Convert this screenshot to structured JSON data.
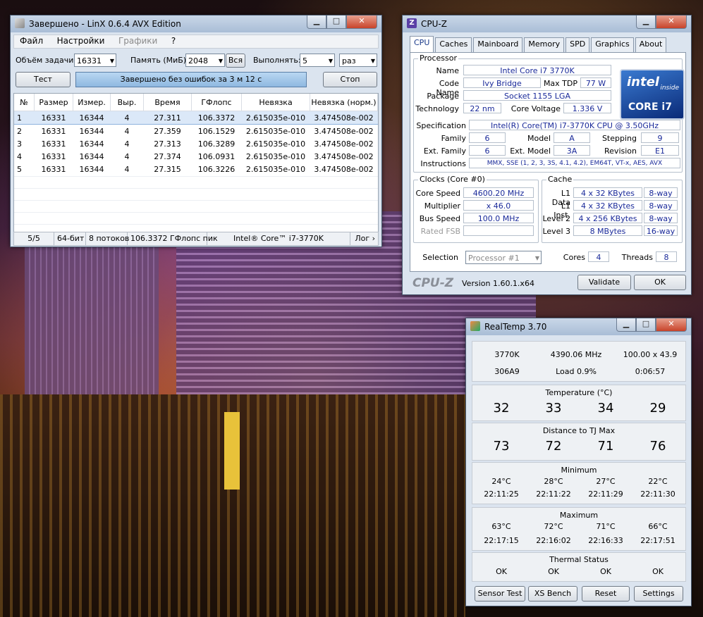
{
  "linx": {
    "title": "Завершено - LinX 0.6.4 AVX Edition",
    "menu": [
      "Файл",
      "Настройки",
      "Графики",
      "?"
    ],
    "problem_size_label": "Объём задачи:",
    "problem_size_value": "16331",
    "memory_label": "Память (МиБ):",
    "memory_value": "2048",
    "all_button": "Вся",
    "run_label": "Выполнять:",
    "run_value": "5",
    "run_unit": "раз",
    "test_button": "Тест",
    "progress_text": "Завершено без ошибок за 3 м 12 с",
    "stop_button": "Стоп",
    "columns": [
      "№",
      "Размер",
      "Измер.",
      "Выр.",
      "Время",
      "ГФлопс",
      "Невязка",
      "Невязка (норм.)"
    ],
    "rows": [
      [
        "1",
        "16331",
        "16344",
        "4",
        "27.311",
        "106.3372",
        "2.615035e-010",
        "3.474508e-002"
      ],
      [
        "2",
        "16331",
        "16344",
        "4",
        "27.359",
        "106.1529",
        "2.615035e-010",
        "3.474508e-002"
      ],
      [
        "3",
        "16331",
        "16344",
        "4",
        "27.313",
        "106.3289",
        "2.615035e-010",
        "3.474508e-002"
      ],
      [
        "4",
        "16331",
        "16344",
        "4",
        "27.374",
        "106.0931",
        "2.615035e-010",
        "3.474508e-002"
      ],
      [
        "5",
        "16331",
        "16344",
        "4",
        "27.315",
        "106.3226",
        "2.615035e-010",
        "3.474508e-002"
      ]
    ],
    "status": {
      "runs": "5/5",
      "bits": "64-бит",
      "threads": "8 потоков",
      "peak": "106.3372 ГФлопс пик",
      "cpu": "Intel® Core™ i7-3770K",
      "log": "Лог ›"
    }
  },
  "cpuz": {
    "title": "CPU-Z",
    "tabs": [
      "CPU",
      "Caches",
      "Mainboard",
      "Memory",
      "SPD",
      "Graphics",
      "About"
    ],
    "processor_label": "Processor",
    "name_label": "Name",
    "name": "Intel Core i7 3770K",
    "codename_label": "Code Name",
    "codename": "Ivy Bridge",
    "tdp_label": "Max TDP",
    "tdp": "77 W",
    "package_label": "Package",
    "package": "Socket 1155 LGA",
    "tech_label": "Technology",
    "tech": "22 nm",
    "voltage_label": "Core Voltage",
    "voltage": "1.336 V",
    "spec_label": "Specification",
    "spec": "Intel(R) Core(TM) i7-3770K CPU @ 3.50GHz",
    "family_label": "Family",
    "family": "6",
    "model_label": "Model",
    "model": "A",
    "stepping_label": "Stepping",
    "stepping": "9",
    "extfamily_label": "Ext. Family",
    "extfamily": "6",
    "extmodel_label": "Ext. Model",
    "extmodel": "3A",
    "revision_label": "Revision",
    "revision": "E1",
    "instr_label": "Instructions",
    "instr": "MMX, SSE (1, 2, 3, 3S, 4.1, 4.2), EM64T, VT-x, AES, AVX",
    "clocks_label": "Clocks (Core #0)",
    "corespeed_label": "Core Speed",
    "corespeed": "4600.20 MHz",
    "mult_label": "Multiplier",
    "mult": "x 46.0",
    "bus_label": "Bus Speed",
    "bus": "100.0 MHz",
    "fsb_label": "Rated FSB",
    "cache_label": "Cache",
    "l1d_label": "L1 Data",
    "l1d": "4 x 32 KBytes",
    "l1d_way": "8-way",
    "l1i_label": "L1 Inst.",
    "l1i": "4 x 32 KBytes",
    "l1i_way": "8-way",
    "l2_label": "Level 2",
    "l2": "4 x 256 KBytes",
    "l2_way": "8-way",
    "l3_label": "Level 3",
    "l3": "8 MBytes",
    "l3_way": "16-way",
    "selection_label": "Selection",
    "selection": "Processor #1",
    "cores_label": "Cores",
    "cores": "4",
    "threads_label": "Threads",
    "threads": "8",
    "logo": "CPU-Z",
    "version": "Version 1.60.1.x64",
    "validate": "Validate",
    "ok": "OK",
    "intel_logo": "intel",
    "intel_inside": "inside",
    "intel_core": "CORE i7"
  },
  "realtemp": {
    "title": "RealTemp 3.70",
    "cpu": "3770K",
    "mhz": "4390.06 MHz",
    "mult": "100.00 x 43.9",
    "cpuid": "306A9",
    "load": "Load  0.9%",
    "time": "0:06:57",
    "temp_label": "Temperature (°C)",
    "temps": [
      "32",
      "33",
      "34",
      "29"
    ],
    "dist_label": "Distance to TJ Max",
    "dists": [
      "73",
      "72",
      "71",
      "76"
    ],
    "min_label": "Minimum",
    "mins": [
      "24°C",
      "28°C",
      "27°C",
      "22°C"
    ],
    "min_times": [
      "22:11:25",
      "22:11:22",
      "22:11:29",
      "22:11:30"
    ],
    "max_label": "Maximum",
    "maxs": [
      "63°C",
      "72°C",
      "71°C",
      "66°C"
    ],
    "max_times": [
      "22:17:15",
      "22:16:02",
      "22:16:33",
      "22:17:51"
    ],
    "thermal_label": "Thermal Status",
    "thermal": [
      "OK",
      "OK",
      "OK",
      "OK"
    ],
    "buttons": [
      "Sensor Test",
      "XS Bench",
      "Reset",
      "Settings"
    ]
  },
  "colors": {
    "value_text": "#1a2a9a",
    "progress": "#8fb8e0",
    "close": "#c8432a"
  }
}
